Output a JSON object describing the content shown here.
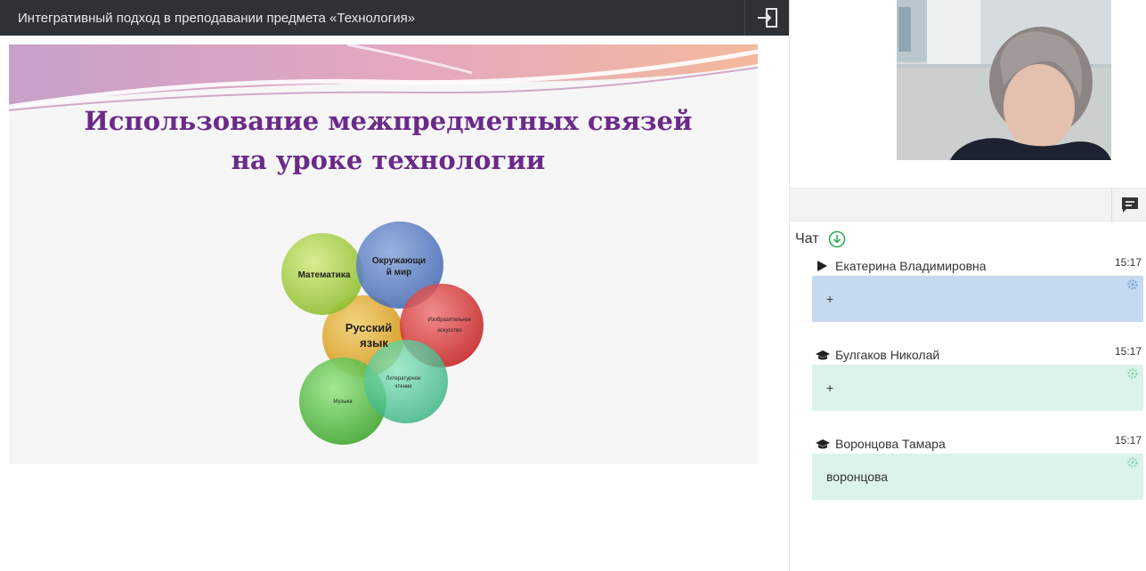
{
  "topbar": {
    "title": "Интегративный подход в преподавании предмета «Технология»",
    "exit_icon": "exit-icon"
  },
  "slide": {
    "title_line1": "Использование межпредметных связей",
    "title_line2": "на уроке технологии",
    "circles": {
      "math": "Математика",
      "world_line1": "Окружающи",
      "world_line2": "й мир",
      "russian_line1": "Русский",
      "russian_line2": "язык",
      "art_line1": "Изобразительное",
      "art_line2": "искусство",
      "lit_line1": "Литературное",
      "lit_line2": "чтение",
      "music": "Музыка"
    }
  },
  "chat": {
    "header": "Чат",
    "messages": [
      {
        "author": "Екатерина Владимировна",
        "time": "15:17",
        "text": "+",
        "icon": "play-icon",
        "color": "#c5d9f1"
      },
      {
        "author": "Булгаков Николай",
        "time": "15:17",
        "text": "+",
        "icon": "graduation-cap-icon",
        "color": "#dbf3e8"
      },
      {
        "author": "Воронцова Тамара",
        "time": "15:17",
        "text": "воронцова",
        "icon": "graduation-cap-icon",
        "color": "#dbf3e8"
      }
    ]
  }
}
